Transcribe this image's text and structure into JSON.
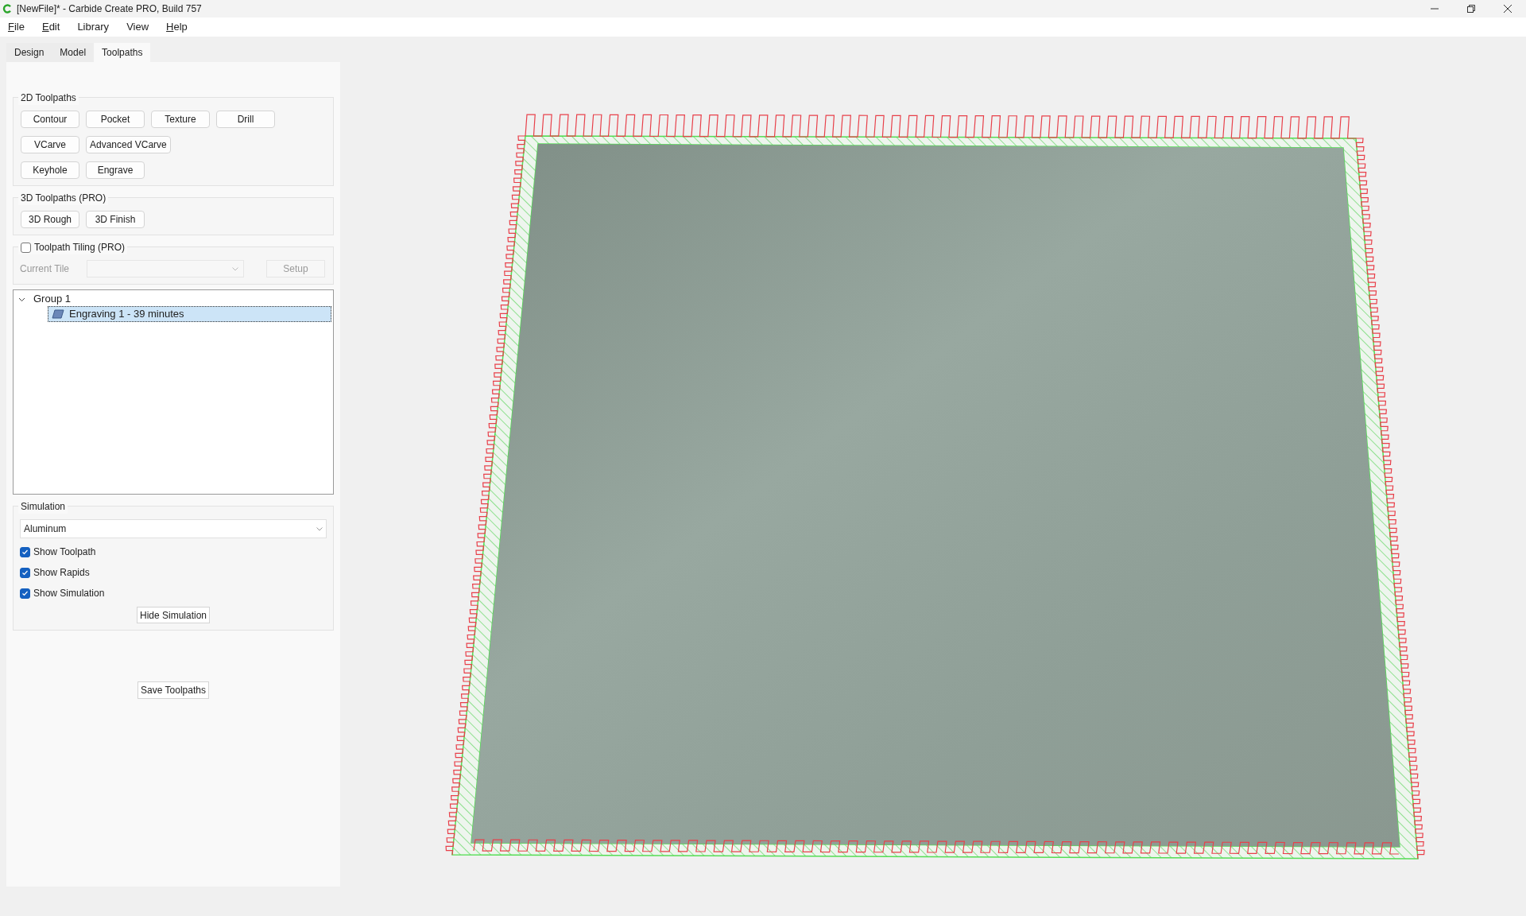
{
  "window": {
    "title": "[NewFile]* - Carbide Create PRO, Build 757"
  },
  "menu": [
    {
      "label": "File",
      "mnemonic": true
    },
    {
      "label": "Edit",
      "mnemonic": true
    },
    {
      "label": "Library",
      "mnemonic": false
    },
    {
      "label": "View",
      "mnemonic": false
    },
    {
      "label": "Help",
      "mnemonic": true
    }
  ],
  "tabs": [
    {
      "label": "Design",
      "selected": false
    },
    {
      "label": "Model",
      "selected": false
    },
    {
      "label": "Toolpaths",
      "selected": true
    }
  ],
  "toolpaths_2d": {
    "title": "2D Toolpaths",
    "rows": [
      [
        "Contour",
        "Pocket",
        "Texture",
        "Drill"
      ],
      [
        "VCarve",
        "Advanced VCarve"
      ],
      [
        "Keyhole",
        "Engrave"
      ]
    ]
  },
  "toolpaths_3d": {
    "title": "3D Toolpaths (PRO)",
    "buttons": [
      "3D Rough",
      "3D Finish"
    ]
  },
  "tiling": {
    "label": "Toolpath Tiling (PRO)",
    "checked": false,
    "disabled": true,
    "current_tile_label": "Current Tile",
    "setup_button": "Setup"
  },
  "tree": [
    {
      "label": "Group 1",
      "expanded": true,
      "children": [
        {
          "label": "Engraving 1 - 39 minutes",
          "selected": true
        }
      ]
    }
  ],
  "simulation": {
    "title": "Simulation",
    "material": "Aluminum",
    "options": [
      {
        "label": "Show Toolpath",
        "checked": true
      },
      {
        "label": "Show Rapids",
        "checked": true
      },
      {
        "label": "Show Simulation",
        "checked": true
      }
    ],
    "hide_button": "Hide Simulation"
  },
  "save_button": "Save Toolpaths"
}
